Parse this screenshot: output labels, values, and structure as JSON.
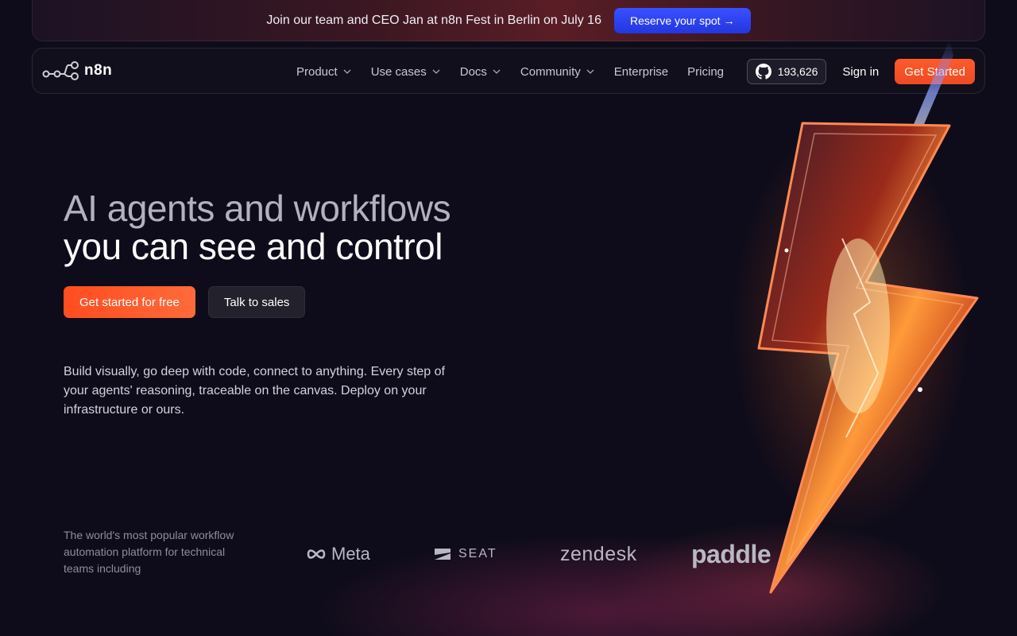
{
  "banner": {
    "text": "Join our team and CEO Jan at n8n Fest in Berlin on July 16",
    "button_label": "Reserve your spot",
    "button_arrow": "→"
  },
  "nav": {
    "logo_text": "n8n",
    "items": [
      {
        "label": "Product",
        "has_dropdown": true
      },
      {
        "label": "Use cases",
        "has_dropdown": true
      },
      {
        "label": "Docs",
        "has_dropdown": true
      },
      {
        "label": "Community",
        "has_dropdown": true
      },
      {
        "label": "Enterprise",
        "has_dropdown": false
      },
      {
        "label": "Pricing",
        "has_dropdown": false
      }
    ],
    "github_stars": "193,626",
    "signin_label": "Sign in",
    "get_started_label": "Get Started"
  },
  "hero": {
    "title_line1": "AI agents and workflows",
    "title_line2": "you can see and control",
    "primary_cta": "Get started for free",
    "secondary_cta": "Talk to sales",
    "description": "Build visually, go deep with code, connect to anything. Every step of your agents' reasoning, traceable on the canvas. Deploy on your infrastructure or ours."
  },
  "trusted": {
    "text": "The world's most popular workflow automation platform for technical teams including",
    "logos": [
      "Meta",
      "SEAT",
      "zendesk",
      "paddle"
    ]
  },
  "colors": {
    "background": "#0e0c1a",
    "accent_orange": "#ff5a2a",
    "banner_button_blue": "#2f44f5"
  }
}
